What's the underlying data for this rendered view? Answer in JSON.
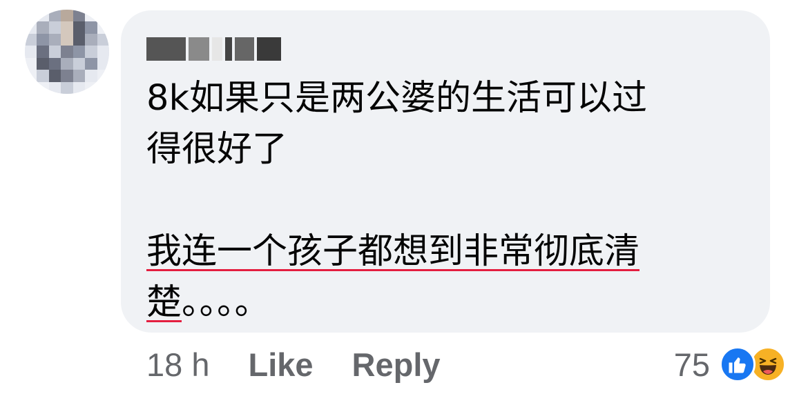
{
  "comment": {
    "lines": [
      "8k如果只是两公婆的生活可以过",
      "得很好了",
      "",
      "我连一个孩子都想到非常彻底清",
      "楚。。。。"
    ],
    "underlined_lines": [
      3,
      4
    ]
  },
  "actions": {
    "time": "18 h",
    "like_label": "Like",
    "reply_label": "Reply"
  },
  "reactions": {
    "count": "75",
    "icons": [
      "like-reaction-icon",
      "haha-reaction-icon"
    ],
    "colors": {
      "like": "#1877f2",
      "haha": "#f7b125"
    }
  },
  "colors": {
    "bubble": "#f0f2f5",
    "text": "#050505",
    "secondary": "#65676b",
    "spellcheck_underline": "#e41e3f"
  }
}
